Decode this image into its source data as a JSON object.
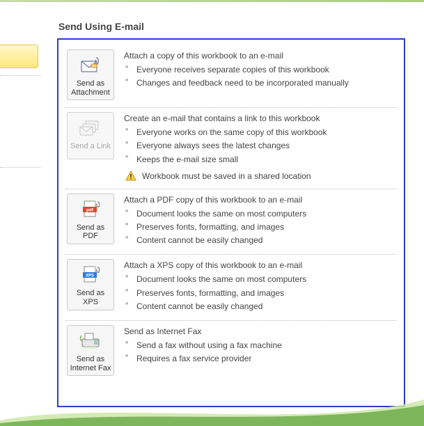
{
  "heading": "Send Using E-mail",
  "options": [
    {
      "button_label": "Send as Attachment",
      "icon": "envelope-clip",
      "disabled": false,
      "title": "Attach a copy of this workbook to an e-mail",
      "bullets": [
        "Everyone receives separate copies of this workbook",
        "Changes and feedback need to be incorporated manually"
      ]
    },
    {
      "button_label": "Send a Link",
      "icon": "envelopes-stack",
      "disabled": true,
      "title": "Create an e-mail that contains a link to this workbook",
      "bullets": [
        "Everyone works on the same copy of this workbook",
        "Everyone always sees the latest changes",
        "Keeps the e-mail size small"
      ],
      "warning": "Workbook must be saved in a shared location"
    },
    {
      "button_label": "Send as PDF",
      "icon": "pdf-clip",
      "disabled": false,
      "title": "Attach a PDF copy of this workbook to an e-mail",
      "bullets": [
        "Document looks the same on most computers",
        "Preserves fonts, formatting, and images",
        "Content cannot be easily changed"
      ]
    },
    {
      "button_label": "Send as XPS",
      "icon": "xps-clip",
      "disabled": false,
      "title": "Attach a XPS copy of this workbook to an e-mail",
      "bullets": [
        "Document looks the same on most computers",
        "Preserves fonts, formatting, and images",
        "Content cannot be easily changed"
      ]
    },
    {
      "button_label": "Send as Internet Fax",
      "icon": "fax",
      "disabled": false,
      "title": "Send as Internet Fax",
      "bullets": [
        "Send a fax without using a fax machine",
        "Requires a fax service provider"
      ]
    }
  ]
}
